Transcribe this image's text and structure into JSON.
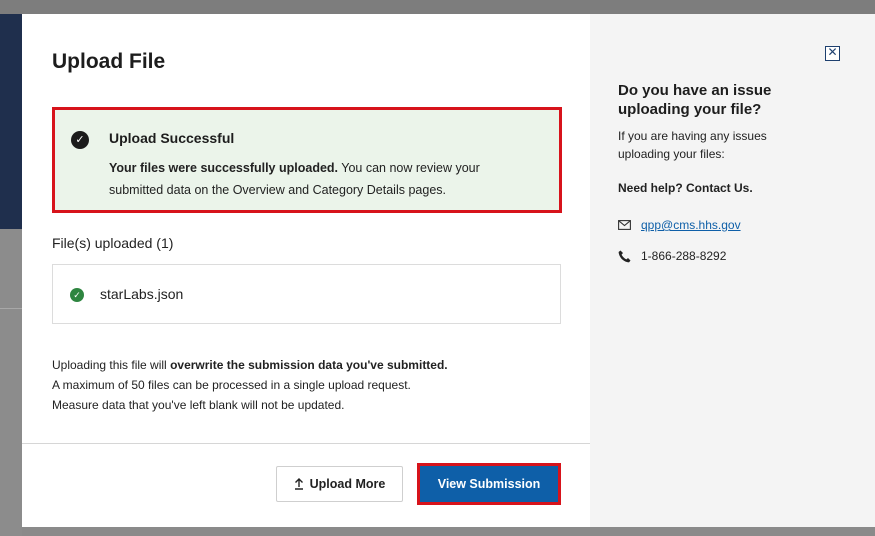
{
  "modal": {
    "title": "Upload File",
    "alert": {
      "heading": "Upload Successful",
      "body_bold": "Your files were successfully uploaded.",
      "body_rest": " You can now review your submitted data on the Overview and Category Details pages."
    },
    "files_label": "File(s) uploaded (1)",
    "files": [
      {
        "name": "starLabs.json",
        "status": "success"
      }
    ],
    "note": {
      "line1_prefix": "Uploading this file will ",
      "line1_bold": "overwrite the submission data you've submitted.",
      "line2": "A maximum of 50 files can be processed in a single upload request.",
      "line3": "Measure data that you've left blank will not be updated."
    },
    "buttons": {
      "upload_more": "Upload More",
      "view_submission": "View Submission"
    }
  },
  "sidebar": {
    "close_label": "✕",
    "heading": "Do you have an issue uploading your file?",
    "text": "If you are having any issues uploading your files:",
    "help": "Need help? Contact Us.",
    "email": "qpp@cms.hhs.gov",
    "phone": "1-866-288-8292"
  },
  "colors": {
    "primary": "#0e5fa8",
    "success_bg": "#ebf4ea",
    "success_check": "#2e8540",
    "highlight": "#d7131b"
  },
  "icons": {
    "alert": "check-circle-icon",
    "file": "check-circle-icon",
    "upload": "upload-arrow-icon",
    "close": "close-icon",
    "email": "mail-icon",
    "phone": "phone-icon"
  }
}
